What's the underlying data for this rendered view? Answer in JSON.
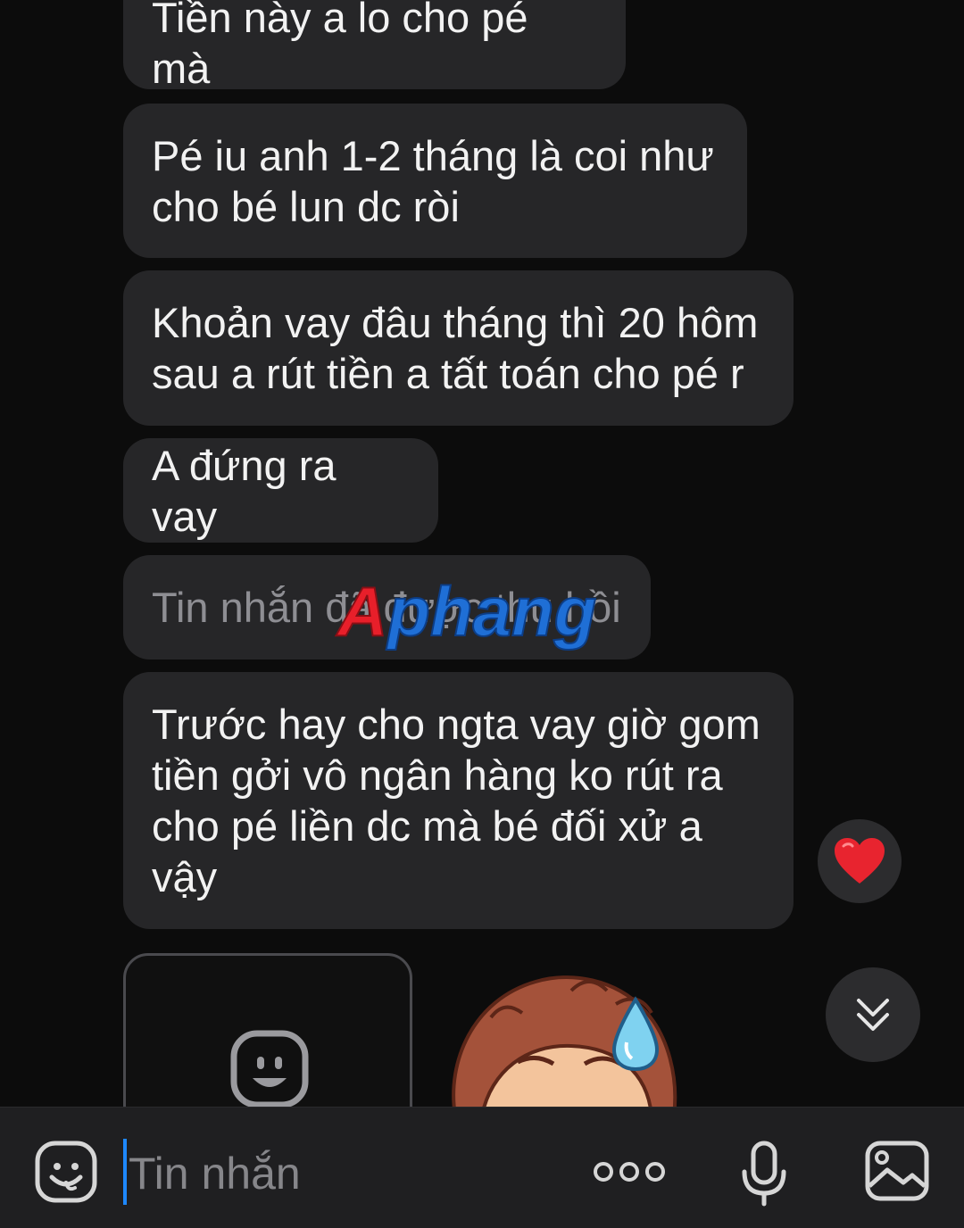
{
  "messages": [
    {
      "text": "Tiền này a lo cho pé mà"
    },
    {
      "text": "Pé iu anh 1-2 tháng là coi như\ncho bé lun dc ròi"
    },
    {
      "text": "Khoản vay đâu tháng thì 20 hôm\nsau a rút tiền a tất toán cho pé r"
    },
    {
      "text": "A đứng ra vay"
    },
    {
      "text": "Tin nhắn đã được thu hồi"
    },
    {
      "text": "Trước hay cho ngta vay giờ gom\ntiền gởi vô ngân hàng ko rút ra\ncho pé liền dc mà bé đối xử a\nvậy"
    }
  ],
  "watermark": {
    "text": "Aphang",
    "color_primary": "#e81f2a",
    "color_secondary": "#1f6fd6"
  },
  "reaction": {
    "icon": "heart-icon",
    "color": "#e8242f"
  },
  "composer": {
    "placeholder": "Tin nhắn",
    "caret_color": "#1e88ff"
  },
  "icons": {
    "emoji": "smiley-icon",
    "more": "more-dots-icon",
    "mic": "microphone-icon",
    "image": "image-icon",
    "scroll": "double-chevron-down-icon"
  }
}
